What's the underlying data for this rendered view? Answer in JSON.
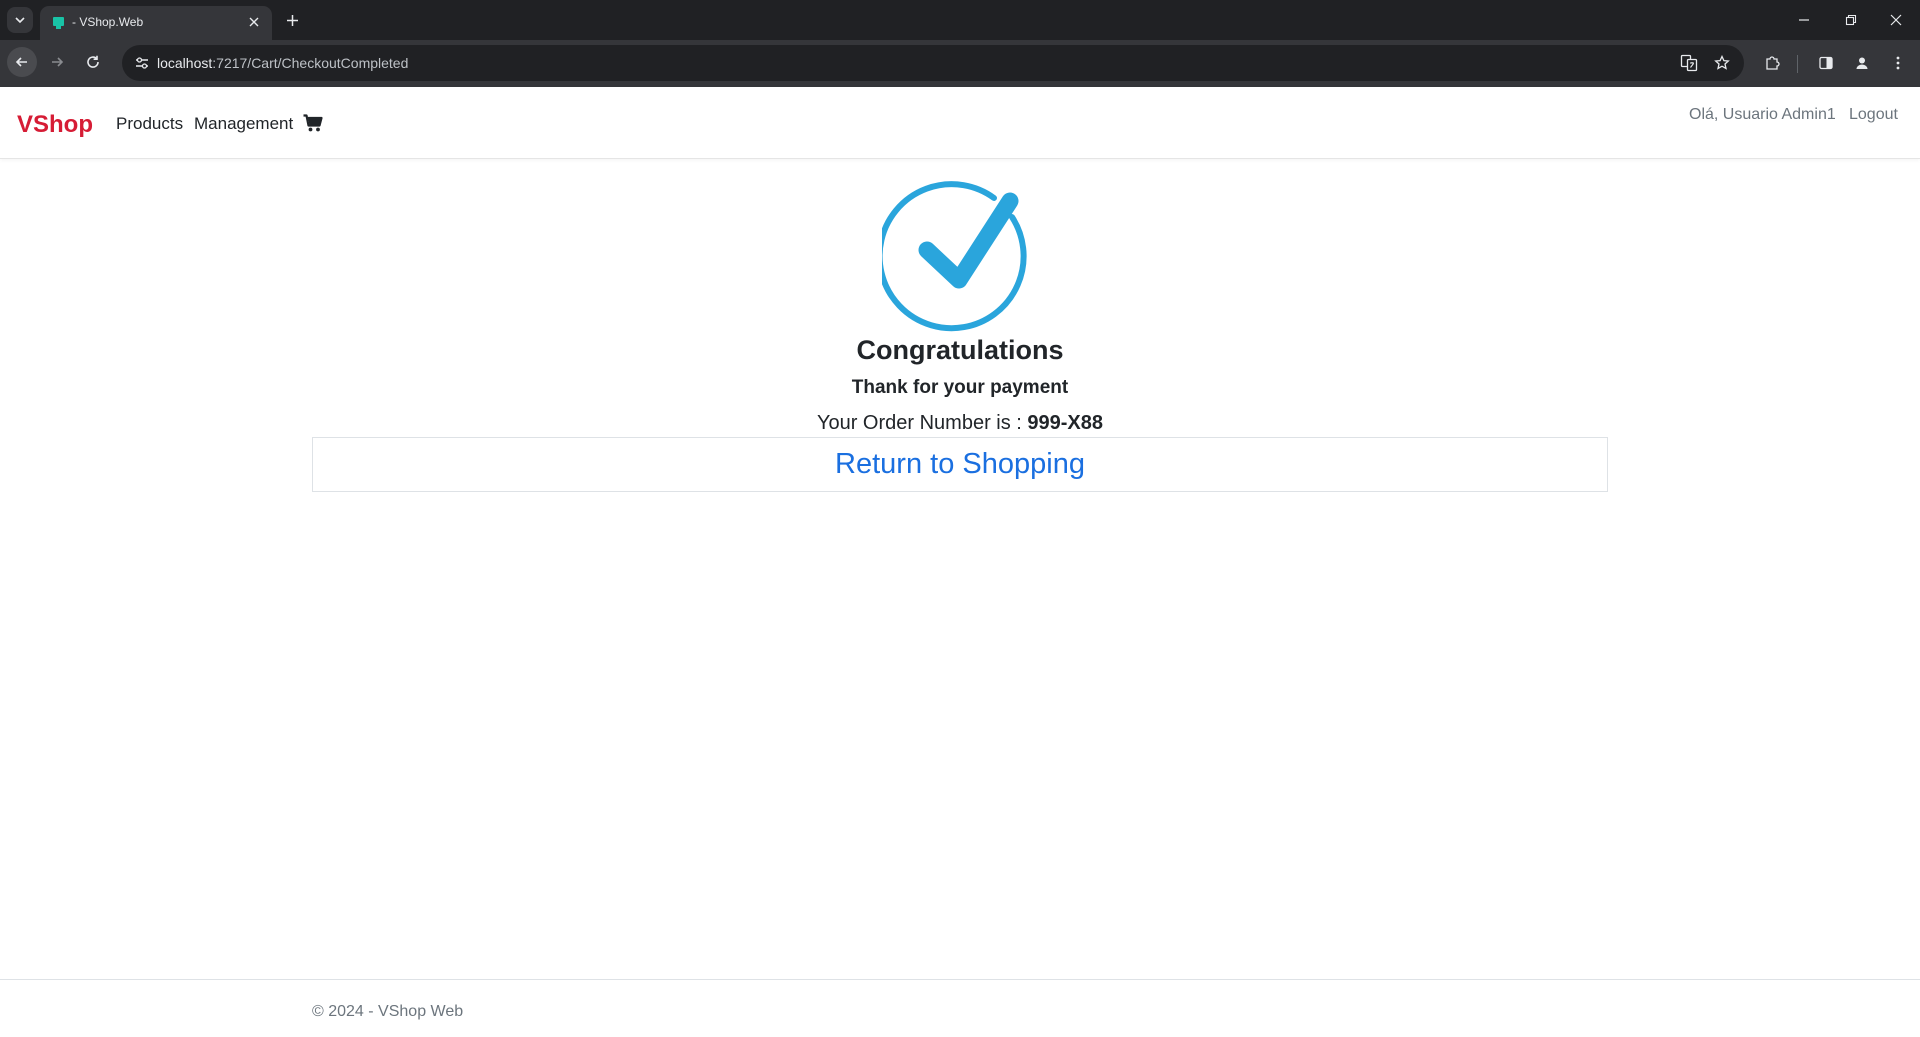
{
  "browser": {
    "tab_title": "- VShop.Web",
    "url_host": "localhost",
    "url_rest": ":7217/Cart/CheckoutCompleted"
  },
  "navbar": {
    "brand": "VShop",
    "links": [
      "Products",
      "Management"
    ],
    "greeting": "Olá, Usuario Admin1",
    "logout": "Logout"
  },
  "main": {
    "icon": "check-circle-icon",
    "title": "Congratulations",
    "subtitle": "Thank for your payment",
    "order_label": "Your Order Number is : ",
    "order_number": "999-X88",
    "return_link": "Return to Shopping"
  },
  "footer": {
    "text": "© 2024 - VShop Web"
  },
  "colors": {
    "brand": "#d61c35",
    "check": "#2aa5dc",
    "link": "#1a6fe0"
  }
}
